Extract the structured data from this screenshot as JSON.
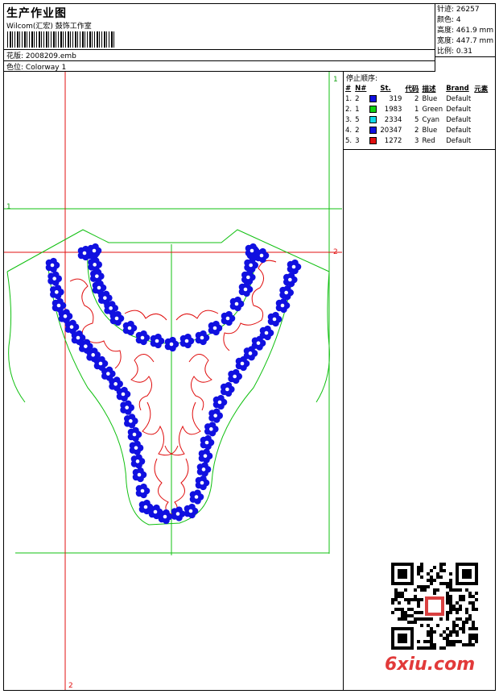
{
  "header": {
    "title": "生产作业图",
    "company": "Wilcom(汇宏) 鼓饰工作室",
    "design_label": "花版:",
    "design_value": "2008209.emb",
    "colorway_label": "色位:",
    "colorway_value": "Colorway 1"
  },
  "stats": [
    {
      "label": "针迹:",
      "value": "26257"
    },
    {
      "label": "颜色:",
      "value": "4"
    },
    {
      "label": "高度:",
      "value": "461.9 mm"
    },
    {
      "label": "宽度:",
      "value": "447.7 mm"
    },
    {
      "label": "比例:",
      "value": "0.31"
    }
  ],
  "sequence": {
    "title": "停止顺序:",
    "columns": [
      "#",
      "N#",
      "",
      "St.",
      "代码",
      "描述",
      "Brand",
      "元素"
    ],
    "rows": [
      {
        "n": "1.",
        "code_n": "2",
        "color": "#1010e0",
        "st": "319",
        "code": "2",
        "desc": "Blue",
        "brand": "Default"
      },
      {
        "n": "2.",
        "code_n": "1",
        "color": "#10d010",
        "st": "1983",
        "code": "1",
        "desc": "Green",
        "brand": "Default"
      },
      {
        "n": "3.",
        "code_n": "5",
        "color": "#10d8e8",
        "st": "2334",
        "code": "5",
        "desc": "Cyan",
        "brand": "Default"
      },
      {
        "n": "4.",
        "code_n": "2",
        "color": "#1010e0",
        "st": "20347",
        "code": "2",
        "desc": "Blue",
        "brand": "Default"
      },
      {
        "n": "5.",
        "code_n": "3",
        "color": "#e01010",
        "st": "1272",
        "code": "3",
        "desc": "Red",
        "brand": "Default"
      }
    ]
  },
  "guides": {
    "m1": "1",
    "m2": "2"
  },
  "watermark": {
    "text": "6xiu.com"
  },
  "colors": {
    "guide_red": "#e01010",
    "guide_green": "#10c010",
    "flower_blue": "#1010e0",
    "outline_red": "#e01010"
  }
}
